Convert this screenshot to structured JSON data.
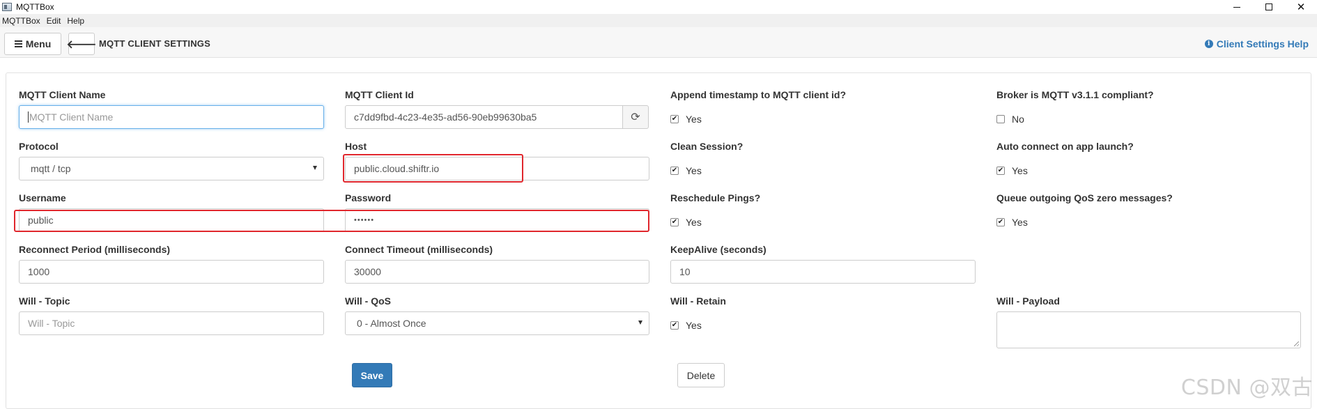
{
  "window": {
    "title": "MQTTBox",
    "minimize_icon": "minimize-icon",
    "maximize_icon": "maximize-icon",
    "close_icon": "close-icon"
  },
  "menubar": {
    "items": [
      "MQTTBox",
      "Edit",
      "Help"
    ]
  },
  "header": {
    "menu_label": "Menu",
    "page_title": "MQTT CLIENT SETTINGS",
    "help_label": "Client Settings Help"
  },
  "form": {
    "client_name": {
      "label": "MQTT Client Name",
      "value": "",
      "placeholder": "MQTT Client Name"
    },
    "client_id": {
      "label": "MQTT Client Id",
      "value": "c7dd9fbd-4c23-4e35-ad56-90eb99630ba5"
    },
    "append_timestamp": {
      "label": "Append timestamp to MQTT client id?",
      "option": "Yes",
      "checked": true
    },
    "broker_compliant": {
      "label": "Broker is MQTT v3.1.1 compliant?",
      "option": "No",
      "checked": false
    },
    "protocol": {
      "label": "Protocol",
      "value": "mqtt / tcp"
    },
    "host": {
      "label": "Host",
      "value": "public.cloud.shiftr.io"
    },
    "clean_session": {
      "label": "Clean Session?",
      "option": "Yes",
      "checked": true
    },
    "auto_connect": {
      "label": "Auto connect on app launch?",
      "option": "Yes",
      "checked": true
    },
    "username": {
      "label": "Username",
      "value": "public"
    },
    "password": {
      "label": "Password",
      "value": "••••••"
    },
    "reschedule_pings": {
      "label": "Reschedule Pings?",
      "option": "Yes",
      "checked": true
    },
    "queue_qos_zero": {
      "label": "Queue outgoing QoS zero messages?",
      "option": "Yes",
      "checked": true
    },
    "reconnect_period": {
      "label": "Reconnect Period (milliseconds)",
      "value": "1000"
    },
    "connect_timeout": {
      "label": "Connect Timeout (milliseconds)",
      "value": "30000"
    },
    "keepalive": {
      "label": "KeepAlive (seconds)",
      "value": "10"
    },
    "will_topic": {
      "label": "Will - Topic",
      "value": "",
      "placeholder": "Will - Topic"
    },
    "will_qos": {
      "label": "Will - QoS",
      "value": "0 - Almost Once"
    },
    "will_retain": {
      "label": "Will - Retain",
      "option": "Yes",
      "checked": true
    },
    "will_payload": {
      "label": "Will - Payload",
      "value": ""
    },
    "save_label": "Save",
    "delete_label": "Delete"
  },
  "watermark": "CSDN @双古",
  "colors": {
    "primary": "#337ab7",
    "highlight": "#e0272d"
  }
}
